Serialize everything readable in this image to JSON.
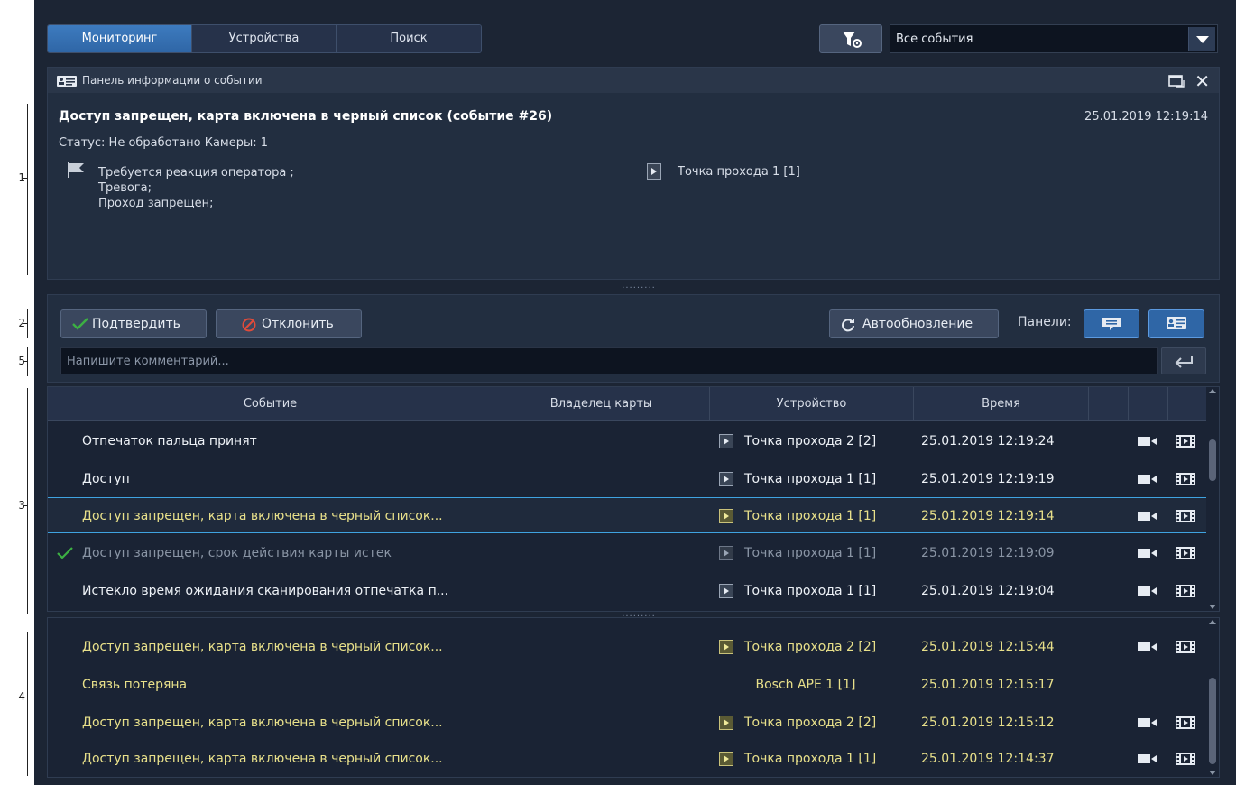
{
  "markers": [
    "1",
    "2",
    "5",
    "3",
    "4"
  ],
  "tabs": [
    {
      "label": "Мониторинг",
      "active": true
    },
    {
      "label": "Устройства",
      "active": false
    },
    {
      "label": "Поиск",
      "active": false
    }
  ],
  "filter": {
    "selected": "Все события"
  },
  "info_panel": {
    "title": "Панель информации о событии",
    "event_title": "Доступ запрещен, карта включена в черный список (событие #26)",
    "event_time": "25.01.2019 12:19:14",
    "status": "Статус: Не обработано Камеры: 1",
    "reactions": [
      "Требуется реакция оператора ;",
      "Тревога;",
      "Проход запрещен;"
    ],
    "gate": "Точка прохода 1 [1]"
  },
  "actions": {
    "confirm_label": "Подтвердить",
    "reject_label": "Отклонить",
    "autoupdate_label": "Автообновление",
    "panels_label": "Панели:"
  },
  "comment": {
    "placeholder": "Напишите комментарий..."
  },
  "table": {
    "columns": [
      "Событие",
      "Владелец карты",
      "Устройство",
      "Время"
    ],
    "rows": [
      {
        "event": "Отпечаток пальца принят",
        "device": "Точка прохода 2 [2]",
        "time": "25.01.2019 12:19:24"
      },
      {
        "event": "Доступ",
        "device": "Точка прохода 1 [1]",
        "time": "25.01.2019 12:19:19"
      },
      {
        "event": "Доступ запрещен, карта включена в черный список...",
        "device": "Точка прохода 1 [1]",
        "time": "25.01.2019 12:19:14"
      },
      {
        "event": "Доступ запрещен, срок действия карты истек",
        "device": "Точка прохода 1 [1]",
        "time": "25.01.2019 12:19:09"
      },
      {
        "event": "Истекло время ожидания сканирования отпечатка п...",
        "device": "Точка прохода 1 [1]",
        "time": "25.01.2019 12:19:04"
      }
    ]
  },
  "table2": {
    "rows": [
      {
        "event": "Доступ запрещен, карта включена в черный список...",
        "device": "Точка прохода 2 [2]",
        "time": "25.01.2019 12:15:44"
      },
      {
        "event": "Связь потеряна",
        "device": "Bosch APE 1 [1]",
        "time": "25.01.2019 12:15:17"
      },
      {
        "event": "Доступ запрещен, карта включена в черный список...",
        "device": "Точка прохода 2 [2]",
        "time": "25.01.2019 12:15:12"
      },
      {
        "event": "Доступ запрещен, карта включена в черный список...",
        "device": "Точка прохода 1 [1]",
        "time": "25.01.2019 12:14:37"
      }
    ]
  },
  "colors": {
    "accent": "#2f66a6",
    "selection": "#3fa3e0",
    "unprocessed_text": "#e8e08a",
    "confirm_check": "#3cb043",
    "reject_icon": "#e04b3a"
  }
}
